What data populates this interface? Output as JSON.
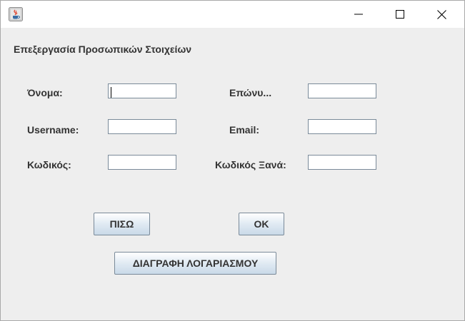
{
  "window": {
    "title": "",
    "controls": {
      "minimize_icon": "minimize-icon",
      "maximize_icon": "maximize-icon",
      "close_icon": "close-icon"
    }
  },
  "form": {
    "heading": "Επεξεργασία Προσωπικών Στοιχείων",
    "fields": {
      "first_name": {
        "label": "Όνομα:",
        "value": ""
      },
      "last_name": {
        "label": "Επώνυ...",
        "value": ""
      },
      "username": {
        "label": "Username:",
        "value": ""
      },
      "email": {
        "label": "Email:",
        "value": ""
      },
      "password": {
        "label": "Κωδικός:",
        "value": ""
      },
      "password_repeat": {
        "label": "Κωδικός Ξανά:",
        "value": ""
      }
    },
    "buttons": {
      "back": "ΠΙΣΩ",
      "ok": "OK",
      "delete_account": "ΔΙΑΓΡΑΦΗ ΛΟΓΑΡΙΑΣΜΟΥ"
    }
  },
  "colors": {
    "background": "#eeeeee",
    "titlebar": "#ffffff",
    "text": "#333333",
    "field_border": "#7a8a99"
  }
}
